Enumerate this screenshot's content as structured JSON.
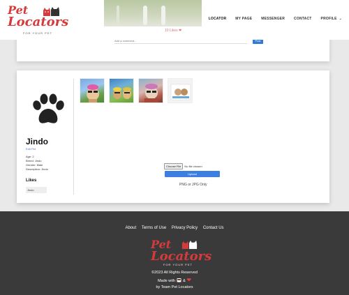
{
  "brand": {
    "line1": "Pet",
    "line2": "Locators",
    "tagline": "FOR YOUR PET"
  },
  "nav": {
    "items": [
      {
        "label": "LOCATOR"
      },
      {
        "label": "MY PAGE"
      },
      {
        "label": "MESSENGER"
      },
      {
        "label": "CONTACT"
      },
      {
        "label": "PROFILE"
      }
    ]
  },
  "prev_post": {
    "likes_text": "10 Likes ❤",
    "comment_placeholder": "Add a comment...",
    "post_label": "Post"
  },
  "profile": {
    "name": "Jindo",
    "link": "Edit Pet",
    "details": [
      "Age: 2",
      "Breed: Jindo",
      "Gender: Male",
      "Description: Jindo"
    ],
    "likes_title": "Likes",
    "likes_items": [
      "Jindo"
    ],
    "choose_file_label": "Choose File",
    "no_file_text": "No file chosen",
    "upload_label": "Upload",
    "hint": "PNG or JPG Only"
  },
  "footer": {
    "links": [
      "About",
      "Terms of Use",
      "Privacy Policy",
      "Contact Us"
    ],
    "copyright": "©2023 All Rights Reserved",
    "made_with": "Made with",
    "amp": "&",
    "by": "by Team Pet Locators"
  },
  "colors": {
    "brand_red": "#d63b3b",
    "button_blue": "#3d7fe0",
    "footer_bg": "#3a3a3a"
  }
}
